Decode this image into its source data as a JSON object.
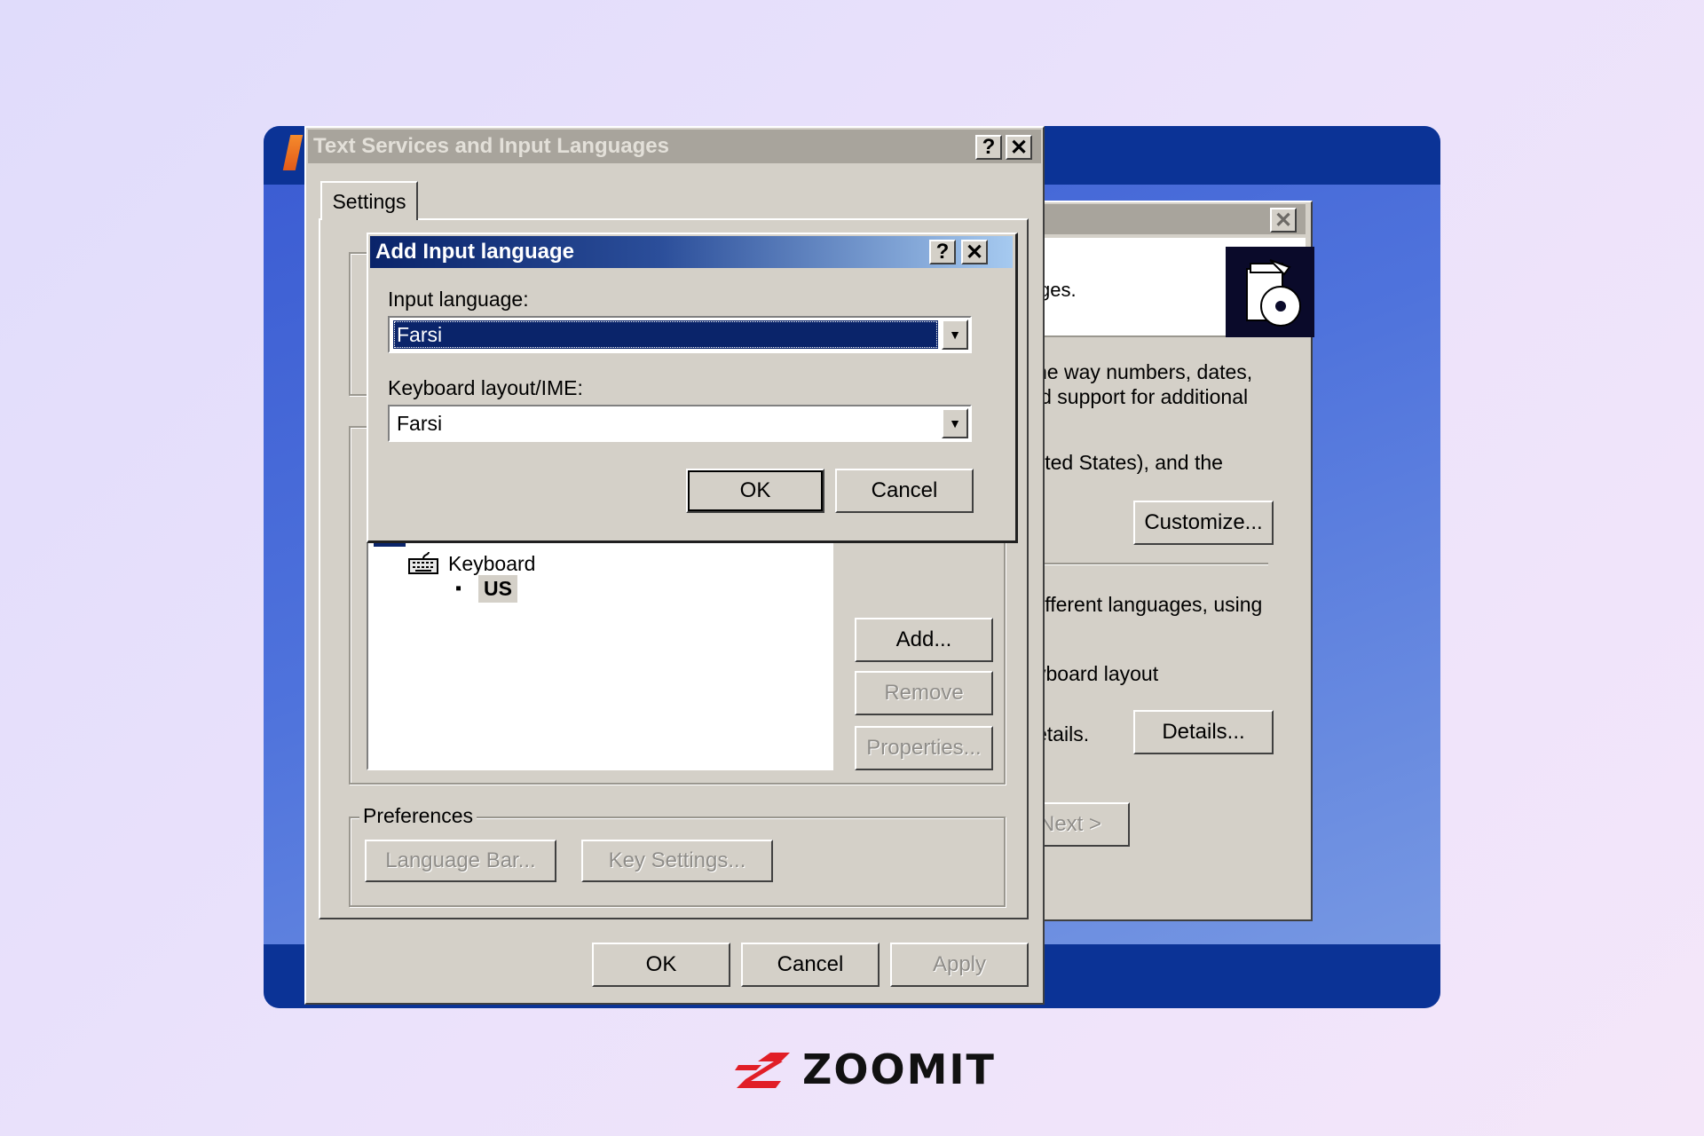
{
  "colors": {
    "background_from": "#e0dcfb",
    "background_to": "#f4e6f9",
    "desktop_blue": "#3a5bd2",
    "taskbar_blue": "#0b3396",
    "dialog_gray": "#d4d0c8",
    "active_title_from": "#0a246a",
    "active_title_to": "#a6caf0",
    "inactive_title": "#a8a49c",
    "logo_red": "#e11e26"
  },
  "back_dialog": {
    "close_icon": "close-icon",
    "header_text": "ges.",
    "cd_icon": "cd-installer-icon",
    "line1": "he way numbers, dates,",
    "line2": "ld support for additional",
    "line3": "iited States), and the",
    "customize_label": "Customize...",
    "line4": "lifferent languages, using",
    "line5": "yboard layout",
    "line6": "etails.",
    "details_label": "Details...",
    "next_label": "Next >"
  },
  "main_dialog": {
    "title": "Text Services and Input Languages",
    "help_label": "?",
    "close_label": "✕",
    "tab_label": "Settings",
    "tree": {
      "keyboard_label": "Keyboard",
      "layout_label": "US"
    },
    "add_label": "Add...",
    "remove_label": "Remove",
    "properties_label": "Properties...",
    "preferences_label": "Preferences",
    "language_bar_label": "Language Bar...",
    "key_settings_label": "Key Settings...",
    "ok_label": "OK",
    "cancel_label": "Cancel",
    "apply_label": "Apply"
  },
  "add_dialog": {
    "title": "Add Input language",
    "help_label": "?",
    "close_label": "✕",
    "input_language_label": "Input language:",
    "input_language_value": "Farsi",
    "keyboard_layout_label": "Keyboard layout/IME:",
    "keyboard_layout_value": "Farsi",
    "ok_label": "OK",
    "cancel_label": "Cancel"
  },
  "logo": {
    "text": "ZOOMIT"
  }
}
